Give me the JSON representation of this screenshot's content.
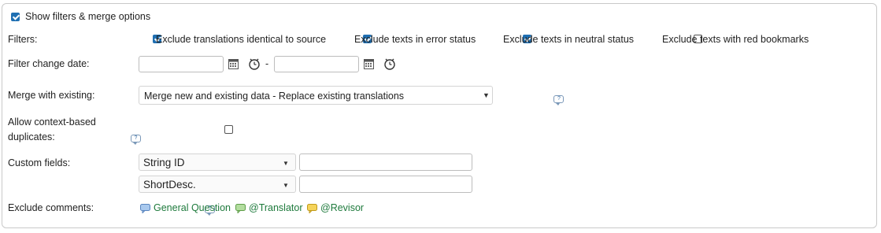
{
  "header": {
    "show_filters_label": "Show filters & merge options",
    "show_filters_checked": true
  },
  "filters": {
    "label": "Filters:",
    "options": [
      {
        "label": "Exclude translations identical to source",
        "checked": true
      },
      {
        "label": "Exclude texts in error status",
        "checked": true
      },
      {
        "label": "Exclude texts in neutral status",
        "checked": true
      },
      {
        "label": "Exclude texts with red bookmarks",
        "checked": false
      }
    ]
  },
  "filter_change_date": {
    "label": "Filter change date:",
    "from_value": "",
    "to_value": "",
    "separator": "-"
  },
  "merge": {
    "label": "Merge with existing:",
    "selected": "Merge new and existing data - Replace existing translations"
  },
  "context_duplicates": {
    "label_line1": "Allow context-based",
    "label_line2": "duplicates:",
    "checked": false
  },
  "custom_fields": {
    "label": "Custom fields:",
    "rows": [
      {
        "field": "String ID",
        "value": ""
      },
      {
        "field": "ShortDesc.",
        "value": ""
      }
    ]
  },
  "exclude_comments": {
    "label": "Exclude comments:",
    "items": [
      {
        "label": "General Question",
        "color": "#8fb8e8"
      },
      {
        "label": "@Translator",
        "color": "#9fd38a"
      },
      {
        "label": "@Revisor",
        "color": "#f2c53d"
      }
    ]
  },
  "help_glyph": "?"
}
